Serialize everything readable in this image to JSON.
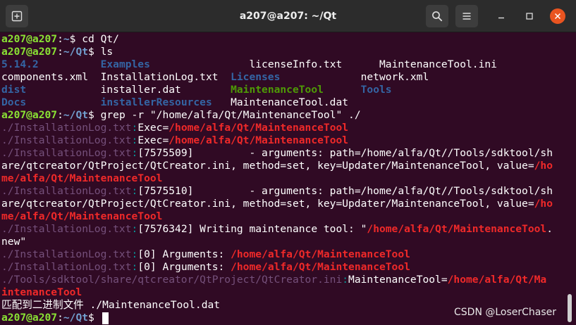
{
  "window": {
    "title": "a207@a207: ~/Qt",
    "icons": {
      "new_tab": "new-tab-icon",
      "search": "search-icon",
      "menu": "hamburger-menu-icon",
      "minimize": "minimize-icon",
      "maximize": "maximize-icon",
      "close": "close-icon"
    }
  },
  "colors": {
    "background": "#300a24",
    "header": "#2c2c2c",
    "prompt_user": "#8ae234",
    "prompt_path": "#729fcf",
    "directory": "#3465a4",
    "executable": "#4e9a06",
    "grep_filename": "#75507b",
    "grep_separator": "#06989a",
    "grep_match": "#ef2929",
    "close_button": "#e95420"
  },
  "terminal": {
    "lines": [
      [
        {
          "t": "a207@a207",
          "c": "prompt-user"
        },
        {
          "t": ":",
          "c": "norm"
        },
        {
          "t": "~",
          "c": "prompt-path"
        },
        {
          "t": "$ cd Qt/",
          "c": "norm"
        }
      ],
      [
        {
          "t": "a207@a207",
          "c": "prompt-user"
        },
        {
          "t": ":",
          "c": "norm"
        },
        {
          "t": "~/Qt",
          "c": "prompt-path"
        },
        {
          "t": "$ ls",
          "c": "norm"
        }
      ],
      [
        {
          "t": "5.14.2",
          "c": "dir"
        },
        {
          "t": "          ",
          "c": "norm"
        },
        {
          "t": "Examples",
          "c": "dir"
        },
        {
          "t": "                ",
          "c": "norm"
        },
        {
          "t": "licenseInfo.txt",
          "c": "norm"
        },
        {
          "t": "      ",
          "c": "norm"
        },
        {
          "t": "MaintenanceTool.ini",
          "c": "norm"
        }
      ],
      [
        {
          "t": "components.xml  InstallationLog.txt  ",
          "c": "norm"
        },
        {
          "t": "Licenses",
          "c": "dir"
        },
        {
          "t": "             network.xml",
          "c": "norm"
        }
      ],
      [
        {
          "t": "dist",
          "c": "dir"
        },
        {
          "t": "            installer.dat        ",
          "c": "norm"
        },
        {
          "t": "MaintenanceTool",
          "c": "exec"
        },
        {
          "t": "      ",
          "c": "norm"
        },
        {
          "t": "Tools",
          "c": "dir"
        }
      ],
      [
        {
          "t": "Docs",
          "c": "dir"
        },
        {
          "t": "            ",
          "c": "norm"
        },
        {
          "t": "installerResources",
          "c": "dir"
        },
        {
          "t": "   MaintenanceTool.dat",
          "c": "norm"
        }
      ],
      [
        {
          "t": "a207@a207",
          "c": "prompt-user"
        },
        {
          "t": ":",
          "c": "norm"
        },
        {
          "t": "~/Qt",
          "c": "prompt-path"
        },
        {
          "t": "$ grep -r \"/home/alfa/Qt/MaintenanceTool\" ./",
          "c": "norm"
        }
      ],
      [
        {
          "t": "./InstallationLog.txt",
          "c": "fn"
        },
        {
          "t": ":",
          "c": "sep"
        },
        {
          "t": "Exec=",
          "c": "norm"
        },
        {
          "t": "/home/alfa/Qt/MaintenanceTool",
          "c": "hl"
        }
      ],
      [
        {
          "t": "./InstallationLog.txt",
          "c": "fn"
        },
        {
          "t": ":",
          "c": "sep"
        },
        {
          "t": "Exec=",
          "c": "norm"
        },
        {
          "t": "/home/alfa/Qt/MaintenanceTool",
          "c": "hl"
        }
      ],
      [
        {
          "t": "./InstallationLog.txt",
          "c": "fn"
        },
        {
          "t": ":",
          "c": "sep"
        },
        {
          "t": "[7575509]         - arguments: path=/home/alfa/Qt//Tools/sdktool/sh",
          "c": "norm"
        }
      ],
      [
        {
          "t": "are/qtcreator/QtProject/QtCreator.ini, method=set, key=Updater/MaintenanceTool, value=",
          "c": "norm"
        },
        {
          "t": "/ho",
          "c": "hl"
        }
      ],
      [
        {
          "t": "me/alfa/Qt/MaintenanceTool",
          "c": "hl"
        }
      ],
      [
        {
          "t": "./InstallationLog.txt",
          "c": "fn"
        },
        {
          "t": ":",
          "c": "sep"
        },
        {
          "t": "[7575510]         - arguments: path=/home/alfa/Qt//Tools/sdktool/sh",
          "c": "norm"
        }
      ],
      [
        {
          "t": "are/qtcreator/QtProject/QtCreator.ini, method=set, key=Updater/MaintenanceTool, value=",
          "c": "norm"
        },
        {
          "t": "/ho",
          "c": "hl"
        }
      ],
      [
        {
          "t": "me/alfa/Qt/MaintenanceTool",
          "c": "hl"
        }
      ],
      [
        {
          "t": "./InstallationLog.txt",
          "c": "fn"
        },
        {
          "t": ":",
          "c": "sep"
        },
        {
          "t": "[7576342] Writing maintenance tool: \"",
          "c": "norm"
        },
        {
          "t": "/home/alfa/Qt/MaintenanceTool",
          "c": "hl"
        },
        {
          "t": ".",
          "c": "norm"
        }
      ],
      [
        {
          "t": "new\"",
          "c": "norm"
        }
      ],
      [
        {
          "t": "./InstallationLog.txt",
          "c": "fn"
        },
        {
          "t": ":",
          "c": "sep"
        },
        {
          "t": "[0] Arguments: ",
          "c": "norm"
        },
        {
          "t": "/home/alfa/Qt/MaintenanceTool",
          "c": "hl"
        }
      ],
      [
        {
          "t": "./InstallationLog.txt",
          "c": "fn"
        },
        {
          "t": ":",
          "c": "sep"
        },
        {
          "t": "[0] Arguments: ",
          "c": "norm"
        },
        {
          "t": "/home/alfa/Qt/MaintenanceTool",
          "c": "hl"
        }
      ],
      [
        {
          "t": "./Tools/sdktool/share/qtcreator/QtProject/QtCreator.ini",
          "c": "fn"
        },
        {
          "t": ":",
          "c": "sep"
        },
        {
          "t": "MaintenanceTool=",
          "c": "norm"
        },
        {
          "t": "/home/alfa/Qt/Ma",
          "c": "hl"
        }
      ],
      [
        {
          "t": "intenanceTool",
          "c": "hl"
        }
      ],
      [
        {
          "t": "匹配到二进制文件 ./MaintenanceTool.dat",
          "c": "norm"
        }
      ],
      [
        {
          "t": "a207@a207",
          "c": "prompt-user"
        },
        {
          "t": ":",
          "c": "norm"
        },
        {
          "t": "~/Qt",
          "c": "prompt-path"
        },
        {
          "t": "$ ",
          "c": "norm"
        }
      ]
    ]
  },
  "watermark": "CSDN @LoserChaser"
}
